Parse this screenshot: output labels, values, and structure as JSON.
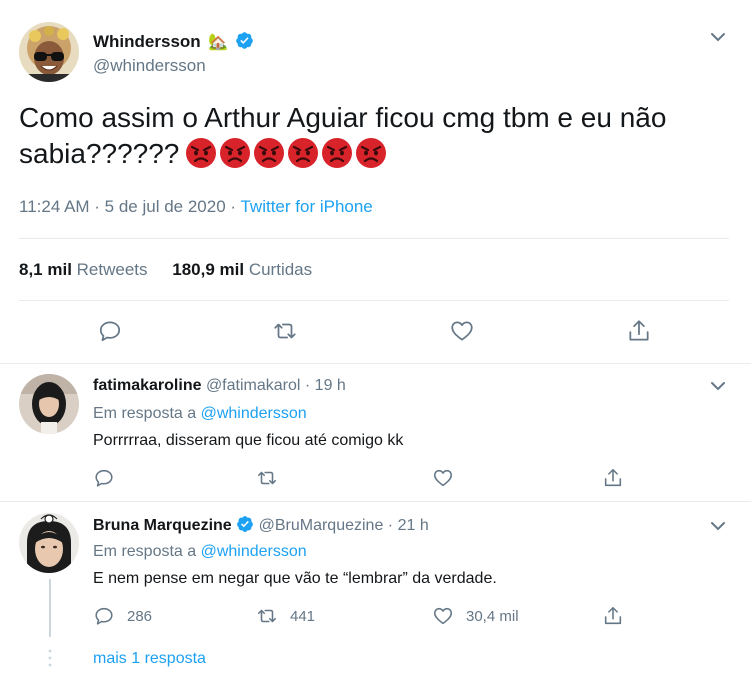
{
  "main_tweet": {
    "name": "Whindersson",
    "house_emoji": "🏡",
    "handle": "@whindersson",
    "text": "Como assim o Arthur Aguiar ficou cmg tbm e eu não sabia??????",
    "emojis": [
      "angry-face",
      "angry-face",
      "angry-face",
      "angry-face",
      "angry-face",
      "angry-face"
    ],
    "time": "11:24 AM · 5 de jul de 2020 ·",
    "source": "Twitter for iPhone",
    "retweets_count": "8,1 mil",
    "retweets_label": "Retweets",
    "likes_count": "180,9 mil",
    "likes_label": "Curtidas",
    "actions": [
      "reply-icon",
      "retweet-icon",
      "like-icon",
      "share-icon"
    ]
  },
  "replies": [
    {
      "name": "fatimakaroline",
      "handle": "@fatimakarol",
      "time": "· 19 h",
      "in_reply_prefix": "Em resposta a",
      "in_reply_handle": "@whindersson",
      "text": "Porrrrraa, disseram que ficou até comigo kk",
      "reply_count": "",
      "retweet_count": "",
      "like_count": ""
    },
    {
      "name": "Bruna Marquezine",
      "handle": "@BruMarquezine",
      "time": "· 21 h",
      "in_reply_prefix": "Em resposta a",
      "in_reply_handle": "@whindersson",
      "text": "E nem pense em negar que vão te “lembrar” da verdade.",
      "reply_count": "286",
      "retweet_count": "441",
      "like_count": "30,4 mil"
    }
  ],
  "more_replies": "mais 1 resposta",
  "colors": {
    "accent": "#1da1f2",
    "secondary_text": "#657786",
    "verified": "#1da1f2",
    "divider": "#e6ecf0"
  }
}
